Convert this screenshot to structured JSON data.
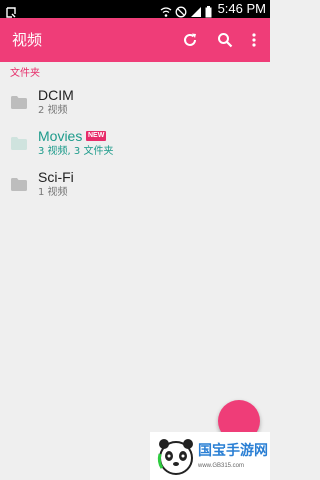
{
  "status_bar": {
    "time": "5:46 PM"
  },
  "app_bar": {
    "title": "视频",
    "actions": [
      "refresh-icon",
      "search-icon",
      "overflow-menu-icon"
    ]
  },
  "section": {
    "header": "文件夹"
  },
  "folders": [
    {
      "name": "DCIM",
      "meta": "2 视频",
      "is_new": false
    },
    {
      "name": "Movies",
      "meta": "3 视频, 3 文件夹",
      "is_new": true,
      "badge": "NEW"
    },
    {
      "name": "Sci-Fi",
      "meta": "1 视频",
      "is_new": false
    }
  ],
  "watermark": {
    "text": "国宝手游网",
    "url": "www.GB315.com"
  },
  "colors": {
    "accent": "#ef3d78",
    "section_header": "#e72d6a",
    "highlight_teal": "#1d9b8b",
    "background": "#efefef"
  }
}
